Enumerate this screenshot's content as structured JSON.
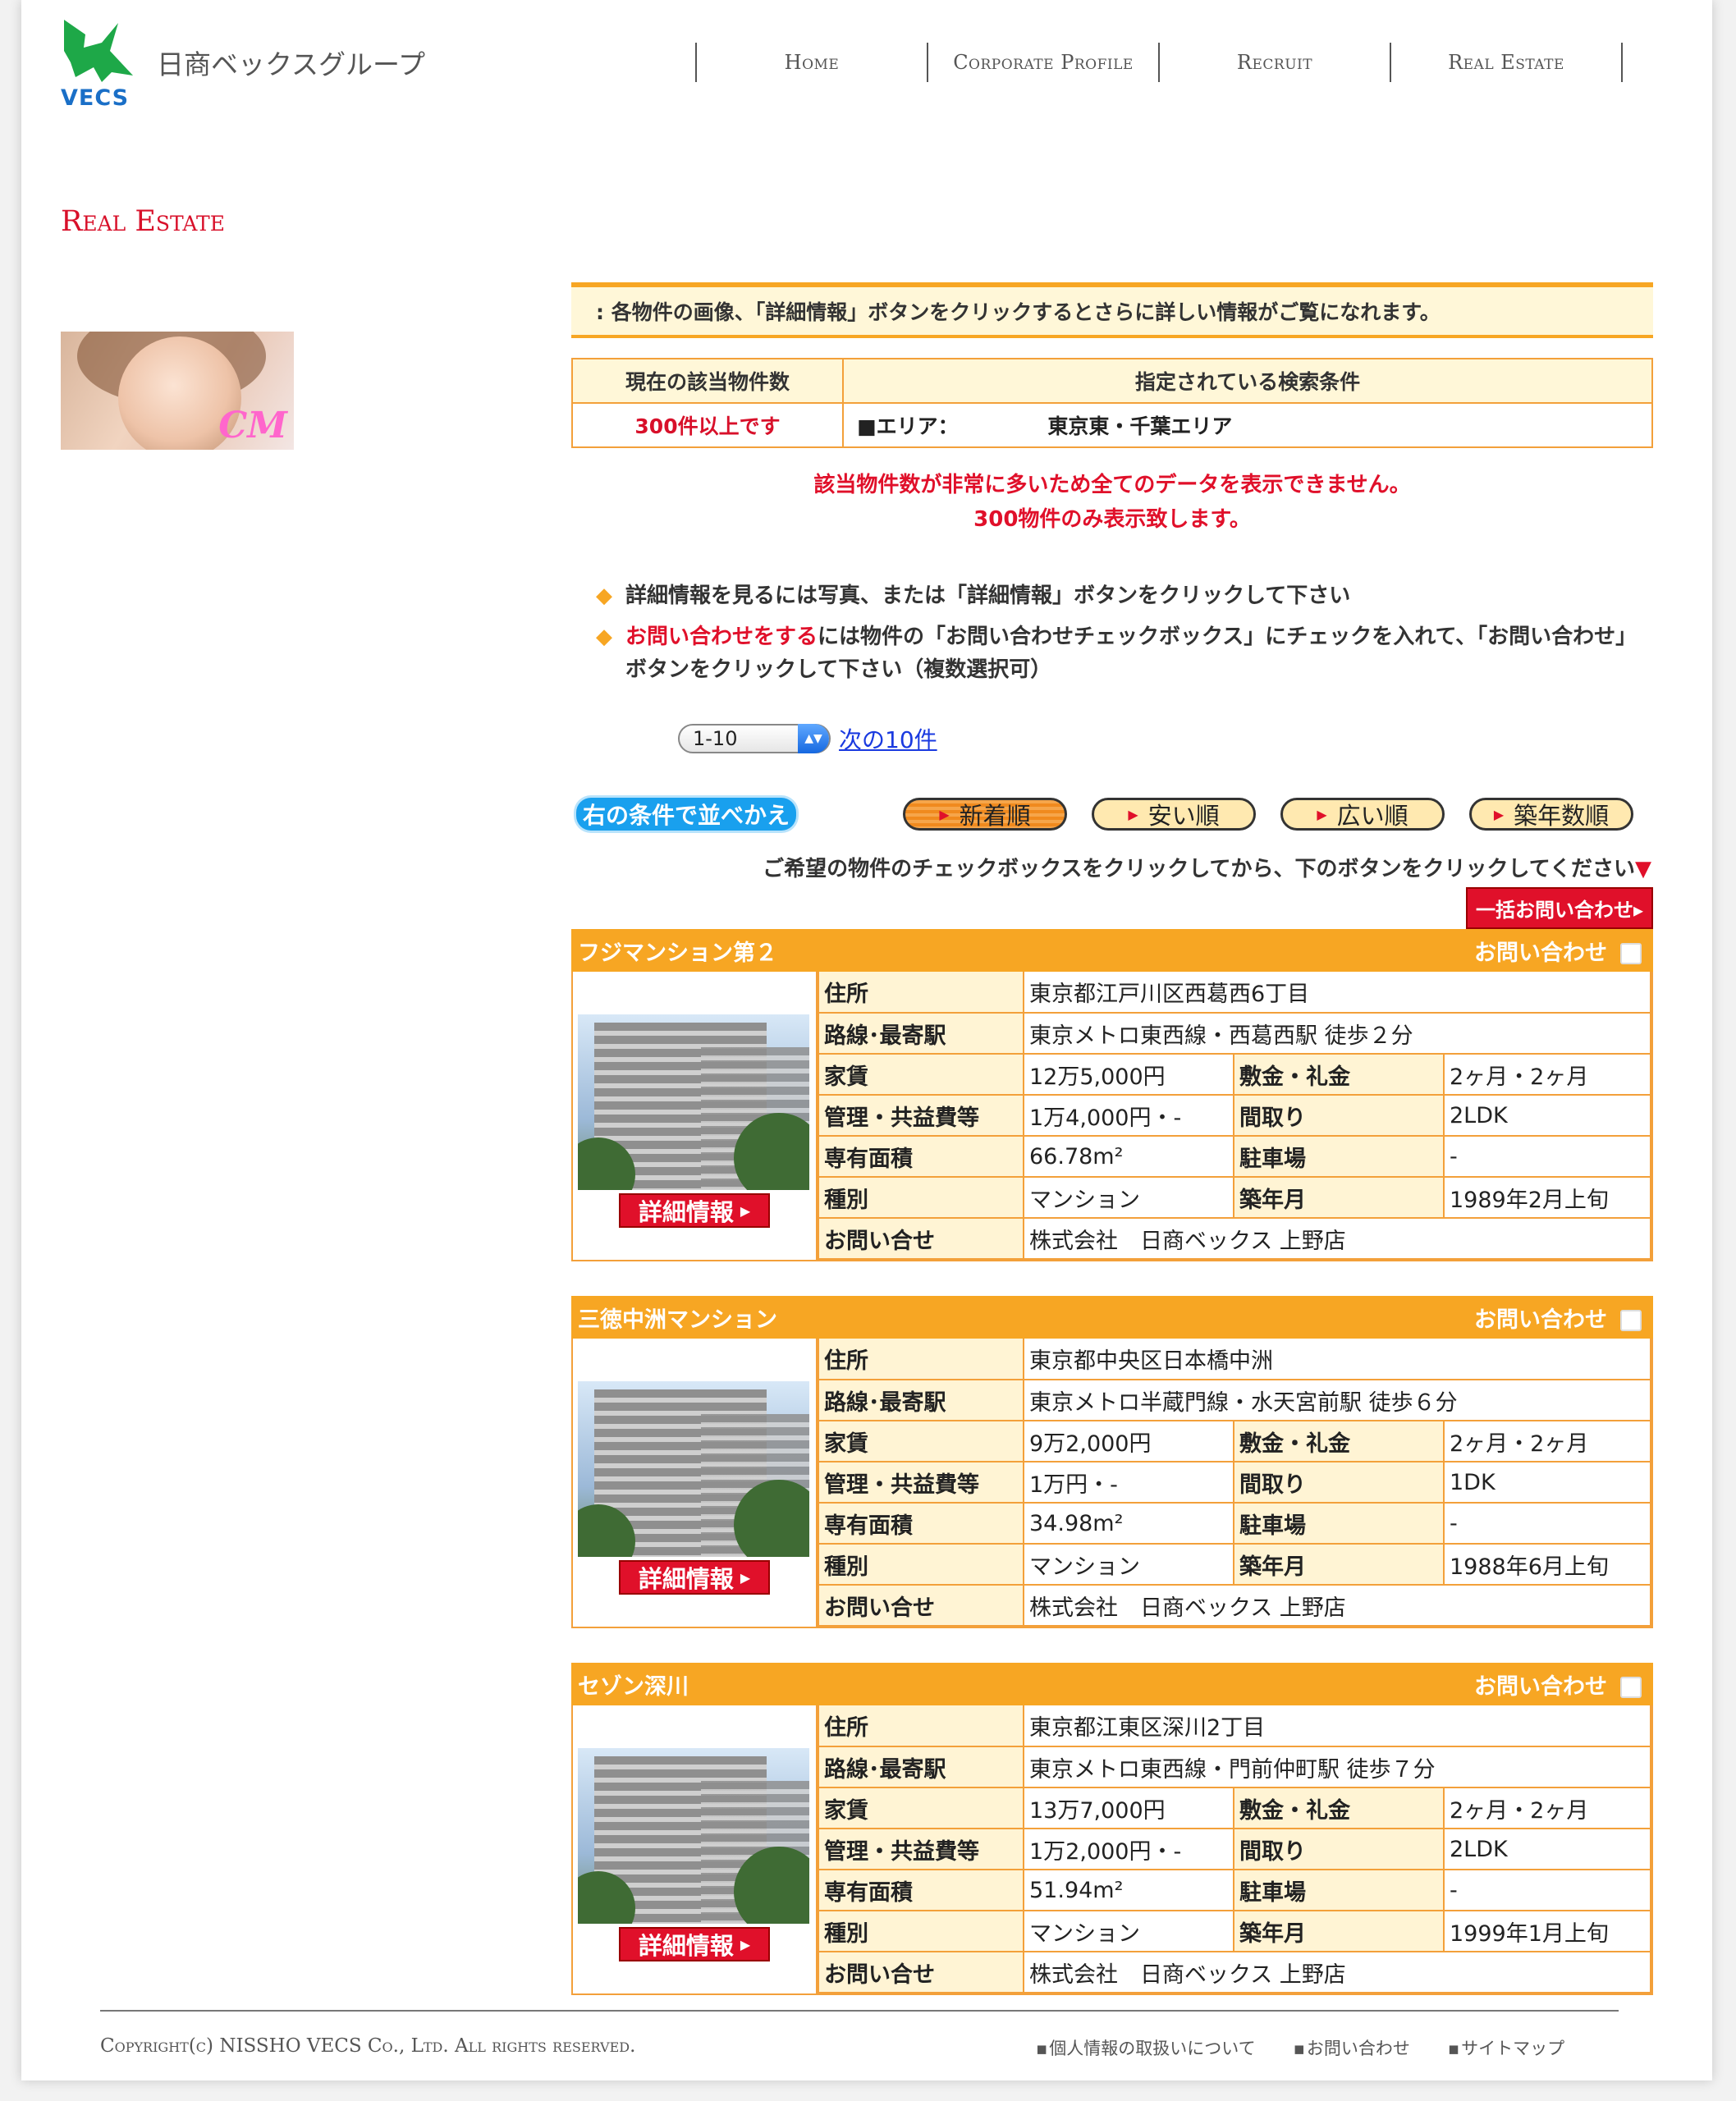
{
  "header": {
    "logo_text": "VECS",
    "brand": "日商ベックスグループ",
    "nav": [
      "Home",
      "Corporate Profile",
      "Recruit",
      "Real Estate"
    ]
  },
  "section_title": "Real Estate",
  "cm_label": "CM",
  "notice": ": 各物件の画像、「詳細情報」ボタンをクリックするとさらに詳しい情報がご覧になれます。",
  "summary": {
    "count_header": "現在の該当物件数",
    "cond_header": "指定されている検索条件",
    "count": "300件以上です",
    "cond_label": "■エリア：",
    "cond_value": "東京東・千葉エリア"
  },
  "warning_1": "該当物件数が非常に多いため全てのデータを表示できません。",
  "warning_2": "300物件のみ表示致します。",
  "bullets": {
    "b1": "詳細情報を見るには写真、または「詳細情報」ボタンをクリックして下さい",
    "b2_red": "お問い合わせをする",
    "b2_rest": "には物件の「お問い合わせチェックボックス」にチェックを入れて、「お問い合わせ」ボタンをクリックして下さい（複数選択可）"
  },
  "pager": {
    "selected": "1-10",
    "next": "次の10件"
  },
  "sort": {
    "label": "右の条件で並べかえ",
    "buttons": [
      "新着順",
      "安い順",
      "広い順",
      "築年数順"
    ]
  },
  "instruction": "ご希望の物件のチェックボックスをクリックしてから、下のボタンをクリックしてください",
  "bulk_button": "一括お問い合わせ▸",
  "inquiry_label": "お問い合わせ",
  "detail_button": "詳細情報",
  "labels": {
    "address": "住所",
    "station": "路線･最寄駅",
    "rent": "家賃",
    "deposit": "敷金・礼金",
    "fee": "管理・共益費等",
    "layout": "間取り",
    "area": "専有面積",
    "parking": "駐車場",
    "type": "種別",
    "built": "築年月",
    "contact": "お問い合せ"
  },
  "listings": [
    {
      "name": "フジマンション第２",
      "address": "東京都江戸川区西葛西6丁目",
      "station": "東京メトロ東西線・西葛西駅 徒歩２分",
      "rent": "12万5,000円",
      "deposit": "2ヶ月・2ヶ月",
      "fee": "1万4,000円・-",
      "layout": "2LDK",
      "area": "66.78m²",
      "parking": "-",
      "type": "マンション",
      "built": "1989年2月上旬",
      "contact": "株式会社　日商ベックス 上野店"
    },
    {
      "name": "三徳中洲マンション",
      "address": "東京都中央区日本橋中洲",
      "station": "東京メトロ半蔵門線・水天宮前駅 徒歩６分",
      "rent": "9万2,000円",
      "deposit": "2ヶ月・2ヶ月",
      "fee": "1万円・-",
      "layout": "1DK",
      "area": "34.98m²",
      "parking": "-",
      "type": "マンション",
      "built": "1988年6月上旬",
      "contact": "株式会社　日商ベックス 上野店"
    },
    {
      "name": "セゾン深川",
      "address": "東京都江東区深川2丁目",
      "station": "東京メトロ東西線・門前仲町駅 徒歩７分",
      "rent": "13万7,000円",
      "deposit": "2ヶ月・2ヶ月",
      "fee": "1万2,000円・-",
      "layout": "2LDK",
      "area": "51.94m²",
      "parking": "-",
      "type": "マンション",
      "built": "1999年1月上旬",
      "contact": "株式会社　日商ベックス 上野店"
    }
  ],
  "footer": {
    "copyright": "Copyright(c) NISSHO VECS Co., Ltd. All rights reserved.",
    "links": [
      "個人情報の取扱いについて",
      "お問い合わせ",
      "サイトマップ"
    ]
  },
  "colors": {
    "accent": "#f7a623",
    "red": "#e0102a",
    "cream": "#fff7d8"
  }
}
